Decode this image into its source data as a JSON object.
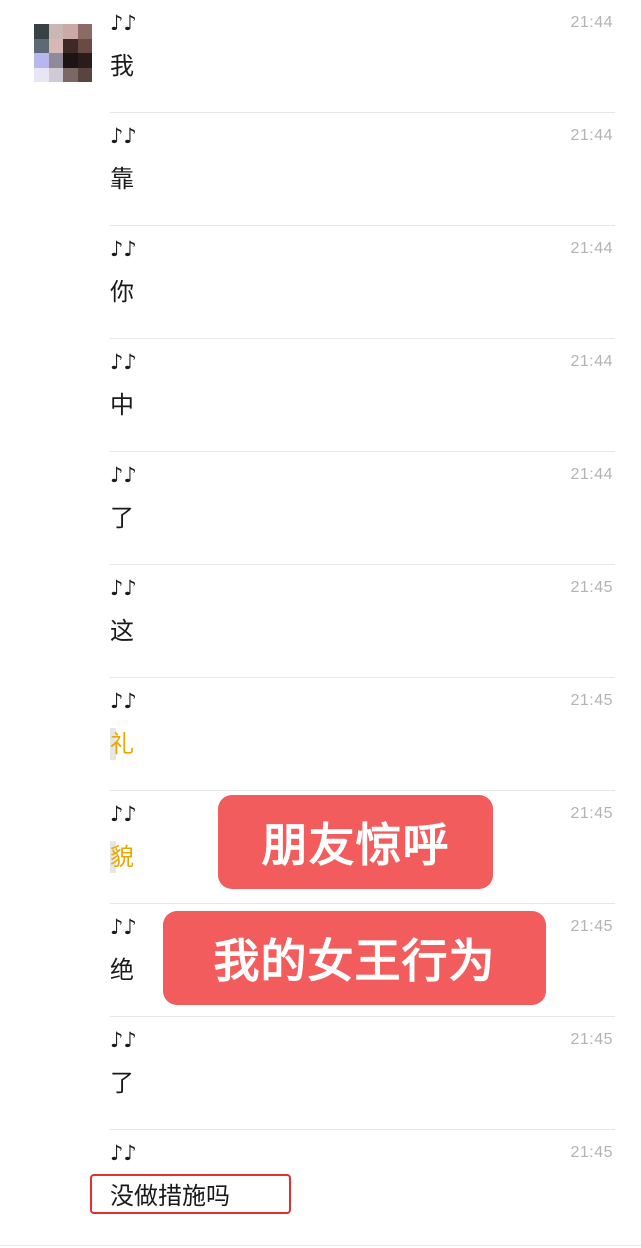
{
  "avatar": {
    "pixels": [
      "#3a4145",
      "#c9b7b4",
      "#caa9a6",
      "#8c6a66",
      "#5d6a75",
      "#d8b8b4",
      "#3d2a27",
      "#6a4a45",
      "#b8b6f0",
      "#8f8a9a",
      "#1c1414",
      "#2a1c1a",
      "#e8e6f2",
      "#cfcad6",
      "#7a6864",
      "#5a4440"
    ]
  },
  "sender_name": "♪♪",
  "messages": [
    {
      "text": "我",
      "time": "21:44"
    },
    {
      "text": "靠",
      "time": "21:44"
    },
    {
      "text": "你",
      "time": "21:44"
    },
    {
      "text": "中",
      "time": "21:44"
    },
    {
      "text": "了",
      "time": "21:44"
    },
    {
      "text": "这",
      "time": "21:45"
    },
    {
      "text": "礼",
      "time": "21:45",
      "highlight": true
    },
    {
      "text": "貌",
      "time": "21:45",
      "highlight": true
    },
    {
      "text": "绝",
      "time": "21:45"
    },
    {
      "text": "了",
      "time": "21:45"
    },
    {
      "text": "没做措施吗",
      "time": "21:45"
    }
  ],
  "overlays": {
    "line1": "朋友惊呼",
    "line2": "我的女王行为"
  },
  "colors": {
    "overlay_bg": "#f25c5c",
    "highlight_text": "#e8a800",
    "annotation_box": "#e03030"
  }
}
